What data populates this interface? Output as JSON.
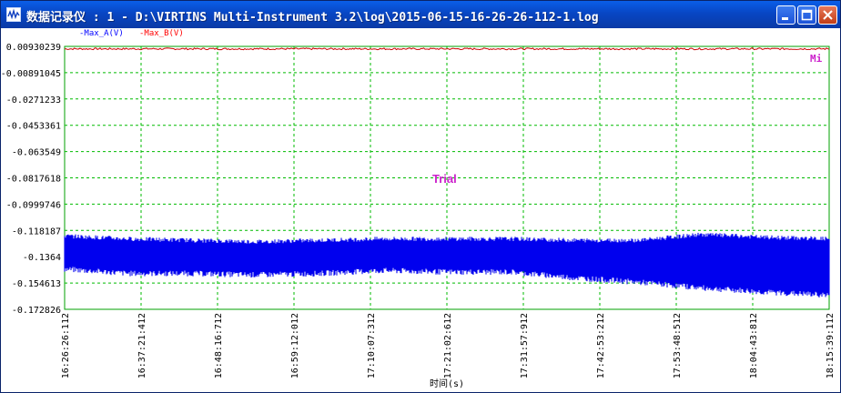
{
  "window": {
    "title": "数据记录仪 : 1 - D:\\VIRTINS Multi-Instrument 3.2\\log\\2015-06-15-16-26-26-112-1.log",
    "minimize_icon": "minimize-icon",
    "maximize_icon": "maximize-icon",
    "close_icon": "close-icon",
    "app_icon": "waveform-icon"
  },
  "chart_data": {
    "type": "line",
    "legend": [
      {
        "name": "-Max_A(V)",
        "color": "#0000ff"
      },
      {
        "name": "-Max_B(V)",
        "color": "#ff0000"
      }
    ],
    "legend_placement": "top-left",
    "ylim": [
      -0.172826,
      0.00930239
    ],
    "yticks": [
      "0.00930239",
      "-0.00891045",
      "-0.0271233",
      "-0.0453361",
      "-0.063549",
      "-0.0817618",
      "-0.0999746",
      "-0.118187",
      "-0.1364",
      "-0.154613",
      "-0.172826"
    ],
    "ytick_values": [
      0.00930239,
      -0.00891045,
      -0.0271233,
      -0.0453361,
      -0.063549,
      -0.0817618,
      -0.0999746,
      -0.118187,
      -0.1364,
      -0.154613,
      -0.172826
    ],
    "xticks": [
      "16:26:26:112",
      "16:37:21:412",
      "16:48:16:712",
      "16:59:12:012",
      "17:10:07:312",
      "17:21:02:612",
      "17:31:57:912",
      "17:42:53:212",
      "17:53:48:512",
      "18:04:43:812",
      "18:15:39:112"
    ],
    "xlabel": "时间(s)",
    "grid": true,
    "watermark": "Trial",
    "corner_label": "Mi",
    "series": [
      {
        "name": "-Max_B(V)",
        "color": "#cc0000",
        "mean": 0.0076,
        "spread": 0.0006
      },
      {
        "name": "-Max_A(V)",
        "color": "#0000ee",
        "upper": [
          -0.122,
          -0.124,
          -0.125,
          -0.126,
          -0.125,
          -0.124,
          -0.124,
          -0.124,
          -0.125,
          -0.125,
          -0.121,
          -0.123,
          -0.124
        ],
        "lower": [
          -0.145,
          -0.148,
          -0.148,
          -0.149,
          -0.148,
          -0.146,
          -0.147,
          -0.147,
          -0.151,
          -0.154,
          -0.158,
          -0.161,
          -0.163
        ]
      }
    ]
  }
}
